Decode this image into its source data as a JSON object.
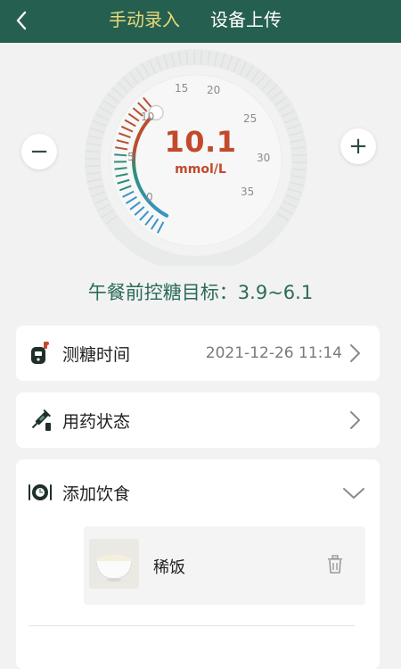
{
  "header": {
    "tabs": [
      {
        "label": "手动录入",
        "active": true
      },
      {
        "label": "设备上传",
        "active": false
      }
    ],
    "back_icon": "chevron-left-icon",
    "background": "#255f50",
    "active_tab_color": "#e8d97a"
  },
  "gauge": {
    "value": "10.1",
    "unit": "mmol/L",
    "min_value": 0,
    "max_value": 35,
    "ticks": [
      "0",
      "5",
      "10",
      "15",
      "20",
      "25",
      "30",
      "35"
    ],
    "decrease_label": "−",
    "increase_label": "+",
    "value_color": "#c24a2c"
  },
  "target": {
    "text": "午餐前控糖目标：3.9~6.1"
  },
  "rows": {
    "time_label": "测糖时间",
    "time_value": "2021-12-26 11:14",
    "medication_label": "用药状态",
    "food_label": "添加饮食"
  },
  "food": {
    "items": [
      {
        "name": "稀饭"
      }
    ]
  }
}
